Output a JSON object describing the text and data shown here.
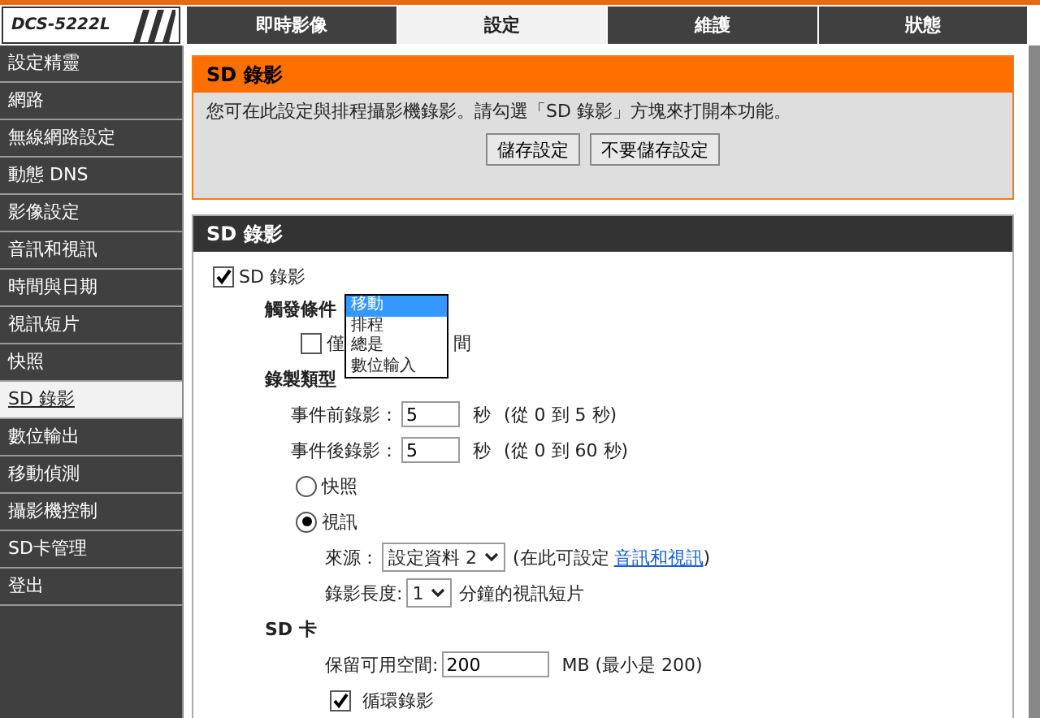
{
  "logo": {
    "text": "DCS-5222L"
  },
  "tabs": [
    {
      "label": "即時影像",
      "selected": false
    },
    {
      "label": "設定",
      "selected": true
    },
    {
      "label": "維護",
      "selected": false
    },
    {
      "label": "狀態",
      "selected": false
    }
  ],
  "sidebar": {
    "items": [
      {
        "label": "設定精靈",
        "selected": false
      },
      {
        "label": "網路",
        "selected": false
      },
      {
        "label": "無線網路設定",
        "selected": false
      },
      {
        "label": "動態 DNS",
        "selected": false
      },
      {
        "label": "影像設定",
        "selected": false
      },
      {
        "label": "音訊和視訊",
        "selected": false
      },
      {
        "label": "時間與日期",
        "selected": false
      },
      {
        "label": "視訊短片",
        "selected": false
      },
      {
        "label": "快照",
        "selected": false
      },
      {
        "label": "SD 錄影",
        "selected": true
      },
      {
        "label": "數位輸出",
        "selected": false
      },
      {
        "label": "移動偵測",
        "selected": false
      },
      {
        "label": "攝影機控制",
        "selected": false
      },
      {
        "label": "SD卡管理",
        "selected": false
      },
      {
        "label": "登出",
        "selected": false
      }
    ]
  },
  "intro_panel": {
    "title": "SD 錄影",
    "description": "您可在此設定與排程攝影機錄影。請勾選「SD 錄影」方塊來打開本功能。",
    "buttons": [
      "儲存設定",
      "不要儲存設定"
    ]
  },
  "settings_panel": {
    "title": "SD 錄影",
    "enable": {
      "label": "SD 錄影",
      "checked": true
    },
    "trigger": {
      "label": "觸發條件",
      "options": [
        {
          "label": "移動",
          "selected": true
        },
        {
          "label": "排程",
          "selected": false
        },
        {
          "label": "總是",
          "selected": false
        },
        {
          "label": "數位輸入",
          "selected": false
        }
      ],
      "schedule_checkbox": {
        "label_start": "僅",
        "label_end": "間",
        "checked": false
      }
    },
    "record_type": {
      "label": "錄製類型",
      "events": [
        {
          "label": "事件前錄影：",
          "value": "5",
          "unit": "秒",
          "hint": "(從 0 到 5 秒)"
        },
        {
          "label": "事件後錄影：",
          "value": "5",
          "unit": "秒",
          "hint": "(從 0 到 60 秒)"
        }
      ],
      "modes": [
        {
          "label": "快照",
          "selected": false
        },
        {
          "label": "視訊",
          "selected": true
        }
      ],
      "source": {
        "label": "來源：",
        "value": "設定資料 2",
        "note": "(在此可設定",
        "link": "音訊和視訊",
        "note_end": ")"
      },
      "length": {
        "label": "錄影長度:",
        "value": "1",
        "note": "分鐘的視訊短片"
      }
    },
    "sd_card": {
      "title": "SD 卡",
      "reserve": {
        "label": "保留可用空間:",
        "value": "200",
        "note": "MB (最小是 200)"
      },
      "cycle": {
        "label": "循環錄影",
        "checked": true
      }
    }
  }
}
